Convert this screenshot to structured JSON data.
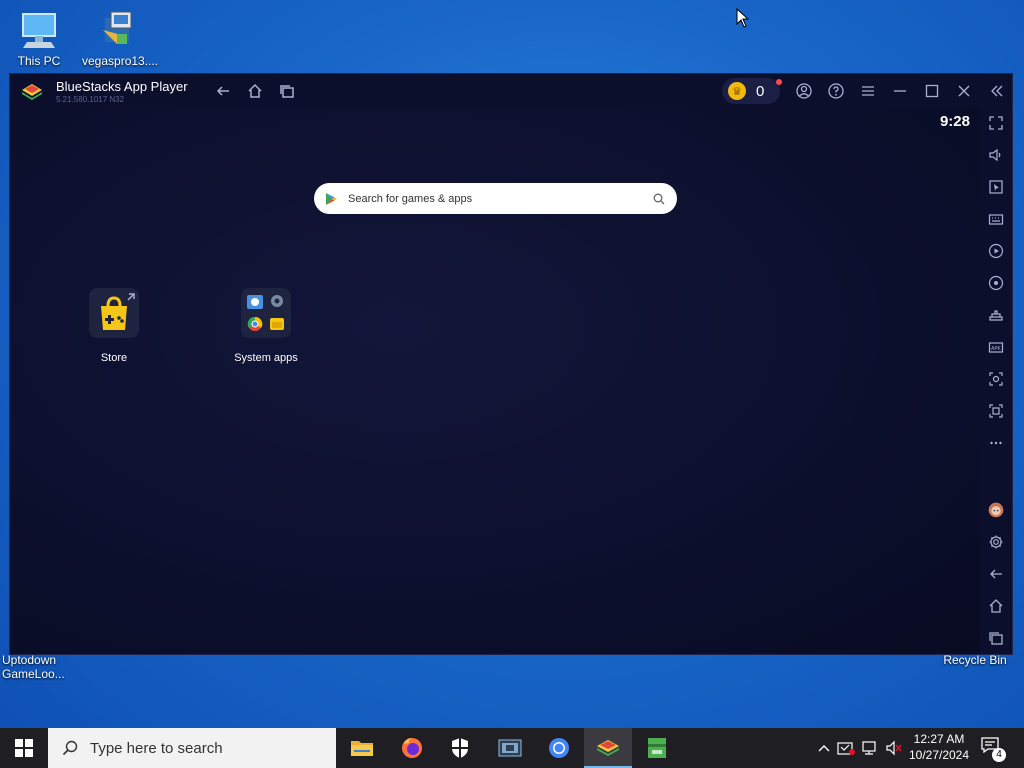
{
  "desktop": {
    "icons": [
      {
        "label": "This PC"
      },
      {
        "label": "vegaspro13...."
      },
      {
        "label": "Uptodown GameLoo..."
      },
      {
        "label": "Recycle Bin"
      }
    ]
  },
  "bluestacks": {
    "title": "BlueStacks App Player",
    "version": "5.21.580.1017 N32",
    "coin_count": "0",
    "clock": "9:28",
    "search_placeholder": "Search for games & apps",
    "apps": [
      {
        "label": "Store"
      },
      {
        "label": "System apps"
      }
    ]
  },
  "taskbar": {
    "search_placeholder": "Type here to search",
    "time": "12:27 AM",
    "date": "10/27/2024",
    "notification_count": "4"
  },
  "colors": {
    "window_bg": "#0d1030",
    "titlebar_bg": "#0c0f2c",
    "coin": "#f2b90e",
    "taskbar_bg": "#1f1f23"
  }
}
